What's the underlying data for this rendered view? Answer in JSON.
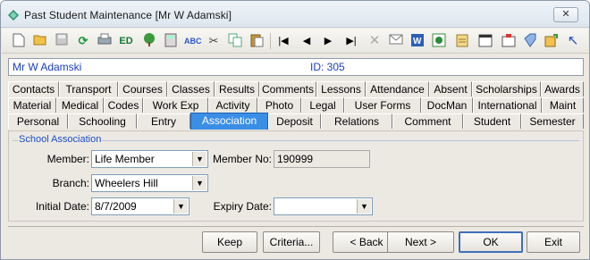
{
  "window": {
    "title": "Past Student Maintenance  [Mr W Adamski]",
    "close_glyph": "✕"
  },
  "toolbar": {
    "icons": [
      "new-document-icon",
      "open-folder-icon",
      "save-icon",
      "refresh-icon",
      "print-icon",
      "edit-id-icon",
      "tree-icon",
      "calculator-icon",
      "spellcheck-icon",
      "cut-icon",
      "copy-icon",
      "paste-icon",
      "first-record-icon",
      "previous-record-icon",
      "next-record-icon",
      "last-record-icon",
      "delete-icon",
      "email-icon",
      "word-icon",
      "excel-icon",
      "report-icon",
      "calendar-icon",
      "schedule-icon",
      "tag-icon",
      "edit-icon",
      "pointer-icon"
    ],
    "edit_id_text": "ED"
  },
  "header": {
    "name": "Mr W Adamski",
    "id_text": "ID: 305"
  },
  "tabs": {
    "row1": [
      "Contacts",
      "Transport",
      "Courses",
      "Classes",
      "Results",
      "Comments",
      "Lessons",
      "Attendance",
      "Absent",
      "Scholarships",
      "Awards"
    ],
    "row2": [
      "Material",
      "Medical",
      "Codes",
      "Work Exp",
      "Activity",
      "Photo",
      "Legal",
      "User Forms",
      "DocMan",
      "International",
      "Maint"
    ],
    "row3": [
      "Personal",
      "Schooling",
      "Entry",
      "Association",
      "Deposit",
      "Relations",
      "Comment",
      "Student",
      "Semester"
    ],
    "active": "Association"
  },
  "form": {
    "group_title": "School Association",
    "member_label": "Member:",
    "member_value": "Life Member",
    "member_no_label": "Member No:",
    "member_no_value": "190999",
    "branch_label": "Branch:",
    "branch_value": "Wheelers Hill",
    "initial_date_label": "Initial Date:",
    "initial_date_value": "8/7/2009",
    "expiry_date_label": "Expiry Date:",
    "expiry_date_value": ""
  },
  "buttons": {
    "keep": "Keep",
    "criteria": "Criteria...",
    "back": "< Back",
    "next": "Next >",
    "ok": "OK",
    "exit": "Exit"
  },
  "colors": {
    "accent": "#3a8ee6",
    "link_text": "#1a3fbf",
    "group_title": "#1c4fc7"
  }
}
